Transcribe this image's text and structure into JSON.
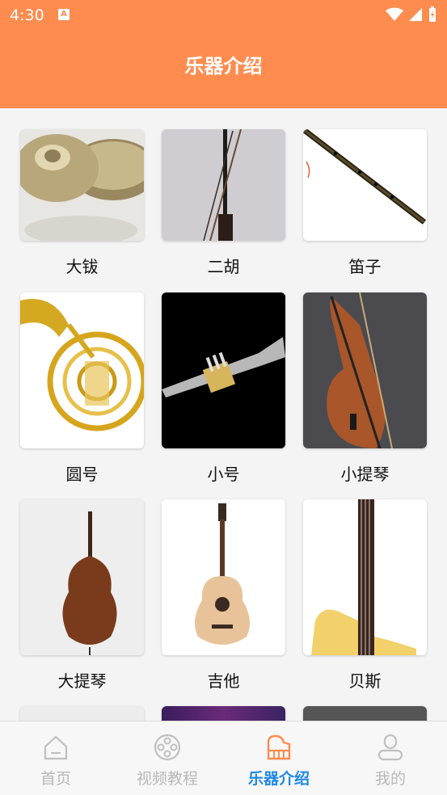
{
  "status": {
    "time": "4:30"
  },
  "header": {
    "title": "乐器介绍"
  },
  "instruments": [
    {
      "name": "大钹"
    },
    {
      "name": "二胡"
    },
    {
      "name": "笛子"
    },
    {
      "name": "圆号"
    },
    {
      "name": "小号"
    },
    {
      "name": "小提琴"
    },
    {
      "name": "大提琴"
    },
    {
      "name": "吉他"
    },
    {
      "name": "贝斯"
    }
  ],
  "nav": {
    "items": [
      {
        "label": "首页",
        "icon": "home-icon"
      },
      {
        "label": "视频教程",
        "icon": "film-reel-icon"
      },
      {
        "label": "乐器介绍",
        "icon": "piano-icon",
        "active": true
      },
      {
        "label": "我的",
        "icon": "user-icon"
      }
    ],
    "active_color": "#1e88e5",
    "inactive_color": "#b8b8b8"
  },
  "colors": {
    "header": "#ff8c4f",
    "background": "#f4f4f4"
  }
}
